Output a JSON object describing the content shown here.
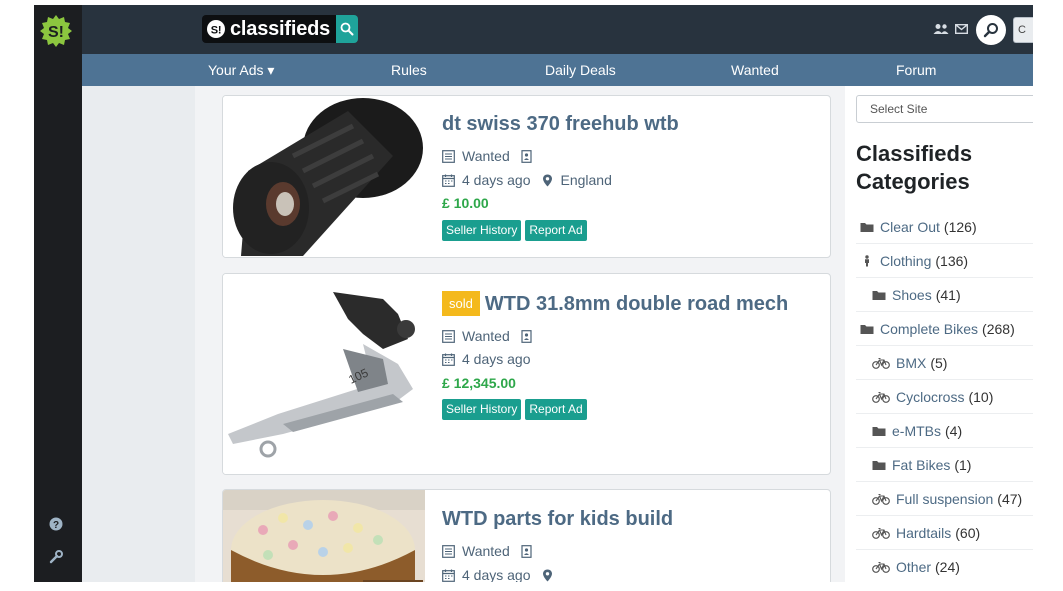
{
  "brand": {
    "name": "classifieds"
  },
  "header": {
    "corner_letter": "C"
  },
  "nav": [
    {
      "label": "Your Ads ▾"
    },
    {
      "label": "Rules"
    },
    {
      "label": "Daily Deals"
    },
    {
      "label": "Wanted"
    },
    {
      "label": "Forum"
    }
  ],
  "listings": [
    {
      "title": "dt swiss 370 freehub wtb",
      "sold": "",
      "type": "Wanted",
      "age": "4 days ago",
      "location": "England",
      "price": "£ 10.00",
      "buttons": [
        "Seller History",
        "Report Ad"
      ]
    },
    {
      "title": "WTD 31.8mm double road mech",
      "sold": "sold",
      "type": "Wanted",
      "age": "4 days ago",
      "location": "",
      "price": "£ 12,345.00",
      "buttons": [
        "Seller History",
        "Report Ad"
      ]
    },
    {
      "title": "WTD parts for kids build",
      "sold": "",
      "type": "Wanted",
      "age": "4 days ago",
      "location": "",
      "price": "",
      "buttons": []
    }
  ],
  "sidebar": {
    "select_label": "Select Site",
    "heading": "Classifieds Categories",
    "categories": [
      {
        "name": "Clear Out",
        "count": "(126)",
        "icon": "folder-icon"
      },
      {
        "name": "Clothing",
        "count": "(136)",
        "icon": "person-icon"
      },
      {
        "name": "Shoes",
        "count": "(41)",
        "icon": "folder-icon"
      },
      {
        "name": "Complete Bikes",
        "count": "(268)",
        "icon": "folder-icon"
      },
      {
        "name": "BMX",
        "count": "(5)",
        "icon": "bicycle-icon"
      },
      {
        "name": "Cyclocross",
        "count": "(10)",
        "icon": "bicycle-icon"
      },
      {
        "name": "e-MTBs",
        "count": "(4)",
        "icon": "folder-icon"
      },
      {
        "name": "Fat Bikes",
        "count": "(1)",
        "icon": "folder-icon"
      },
      {
        "name": "Full suspension",
        "count": "(47)",
        "icon": "bicycle-icon"
      },
      {
        "name": "Hardtails",
        "count": "(60)",
        "icon": "bicycle-icon"
      },
      {
        "name": "Other",
        "count": "(24)",
        "icon": "bicycle-icon"
      }
    ]
  },
  "colors": {
    "header_bg": "#28333e",
    "nav_bg": "#4e7394",
    "accent_teal": "#1a9e8f",
    "price_green": "#2ea74a",
    "sold_badge": "#f4b91c",
    "link_blue": "#4d6a84",
    "logo_green": "#8cc63f"
  }
}
